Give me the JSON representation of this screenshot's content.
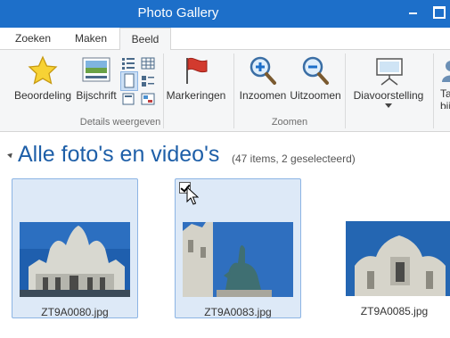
{
  "window": {
    "title": "Photo Gallery",
    "controls": [
      "minimize-icon",
      "maximize-icon"
    ]
  },
  "tabs": [
    {
      "label": "Zoeken",
      "active": false
    },
    {
      "label": "Maken",
      "active": false
    },
    {
      "label": "Beeld",
      "active": true
    }
  ],
  "ribbon": {
    "groups": [
      {
        "label": "Details weergeven",
        "buttons": [
          {
            "label": "Beoordeling",
            "icon": "star-icon"
          },
          {
            "label": "Bijschrift",
            "icon": "caption-icon"
          }
        ],
        "small_buttons": [
          "thumbnail-view-icon",
          "details-view-icon",
          "page-view-icon",
          "tile-view-icon",
          "list-view-icon",
          "details-list-icon"
        ]
      },
      {
        "label": "",
        "buttons": [
          {
            "label": "Markeringen",
            "icon": "flag-icon"
          }
        ]
      },
      {
        "label": "Zoomen",
        "buttons": [
          {
            "label": "Inzoomen",
            "icon": "zoom-in-icon"
          },
          {
            "label": "Uitzoomen",
            "icon": "zoom-out-icon"
          }
        ]
      },
      {
        "label": "",
        "buttons": [
          {
            "label": "Diavoorstelling",
            "icon": "slideshow-icon",
            "has_dropdown": true
          }
        ]
      },
      {
        "label": "",
        "buttons": [
          {
            "label": "Ta bij",
            "icon": "people-icon"
          }
        ]
      }
    ]
  },
  "gallery": {
    "title": "Alle foto's en video's",
    "count": "(47 items, 2 geselecteerd)",
    "items": [
      {
        "filename": "ZT9A0080.jpg",
        "selected": true,
        "checked": false
      },
      {
        "filename": "ZT9A0083.jpg",
        "selected": true,
        "checked": true
      },
      {
        "filename": "ZT9A0085.jpg",
        "selected": false,
        "checked": false
      }
    ]
  },
  "colors": {
    "titlebar": "#1d6fc9",
    "ribbon": "#f5f6f7",
    "selection": "#dde9f7",
    "section_title": "#1e5fa8"
  }
}
